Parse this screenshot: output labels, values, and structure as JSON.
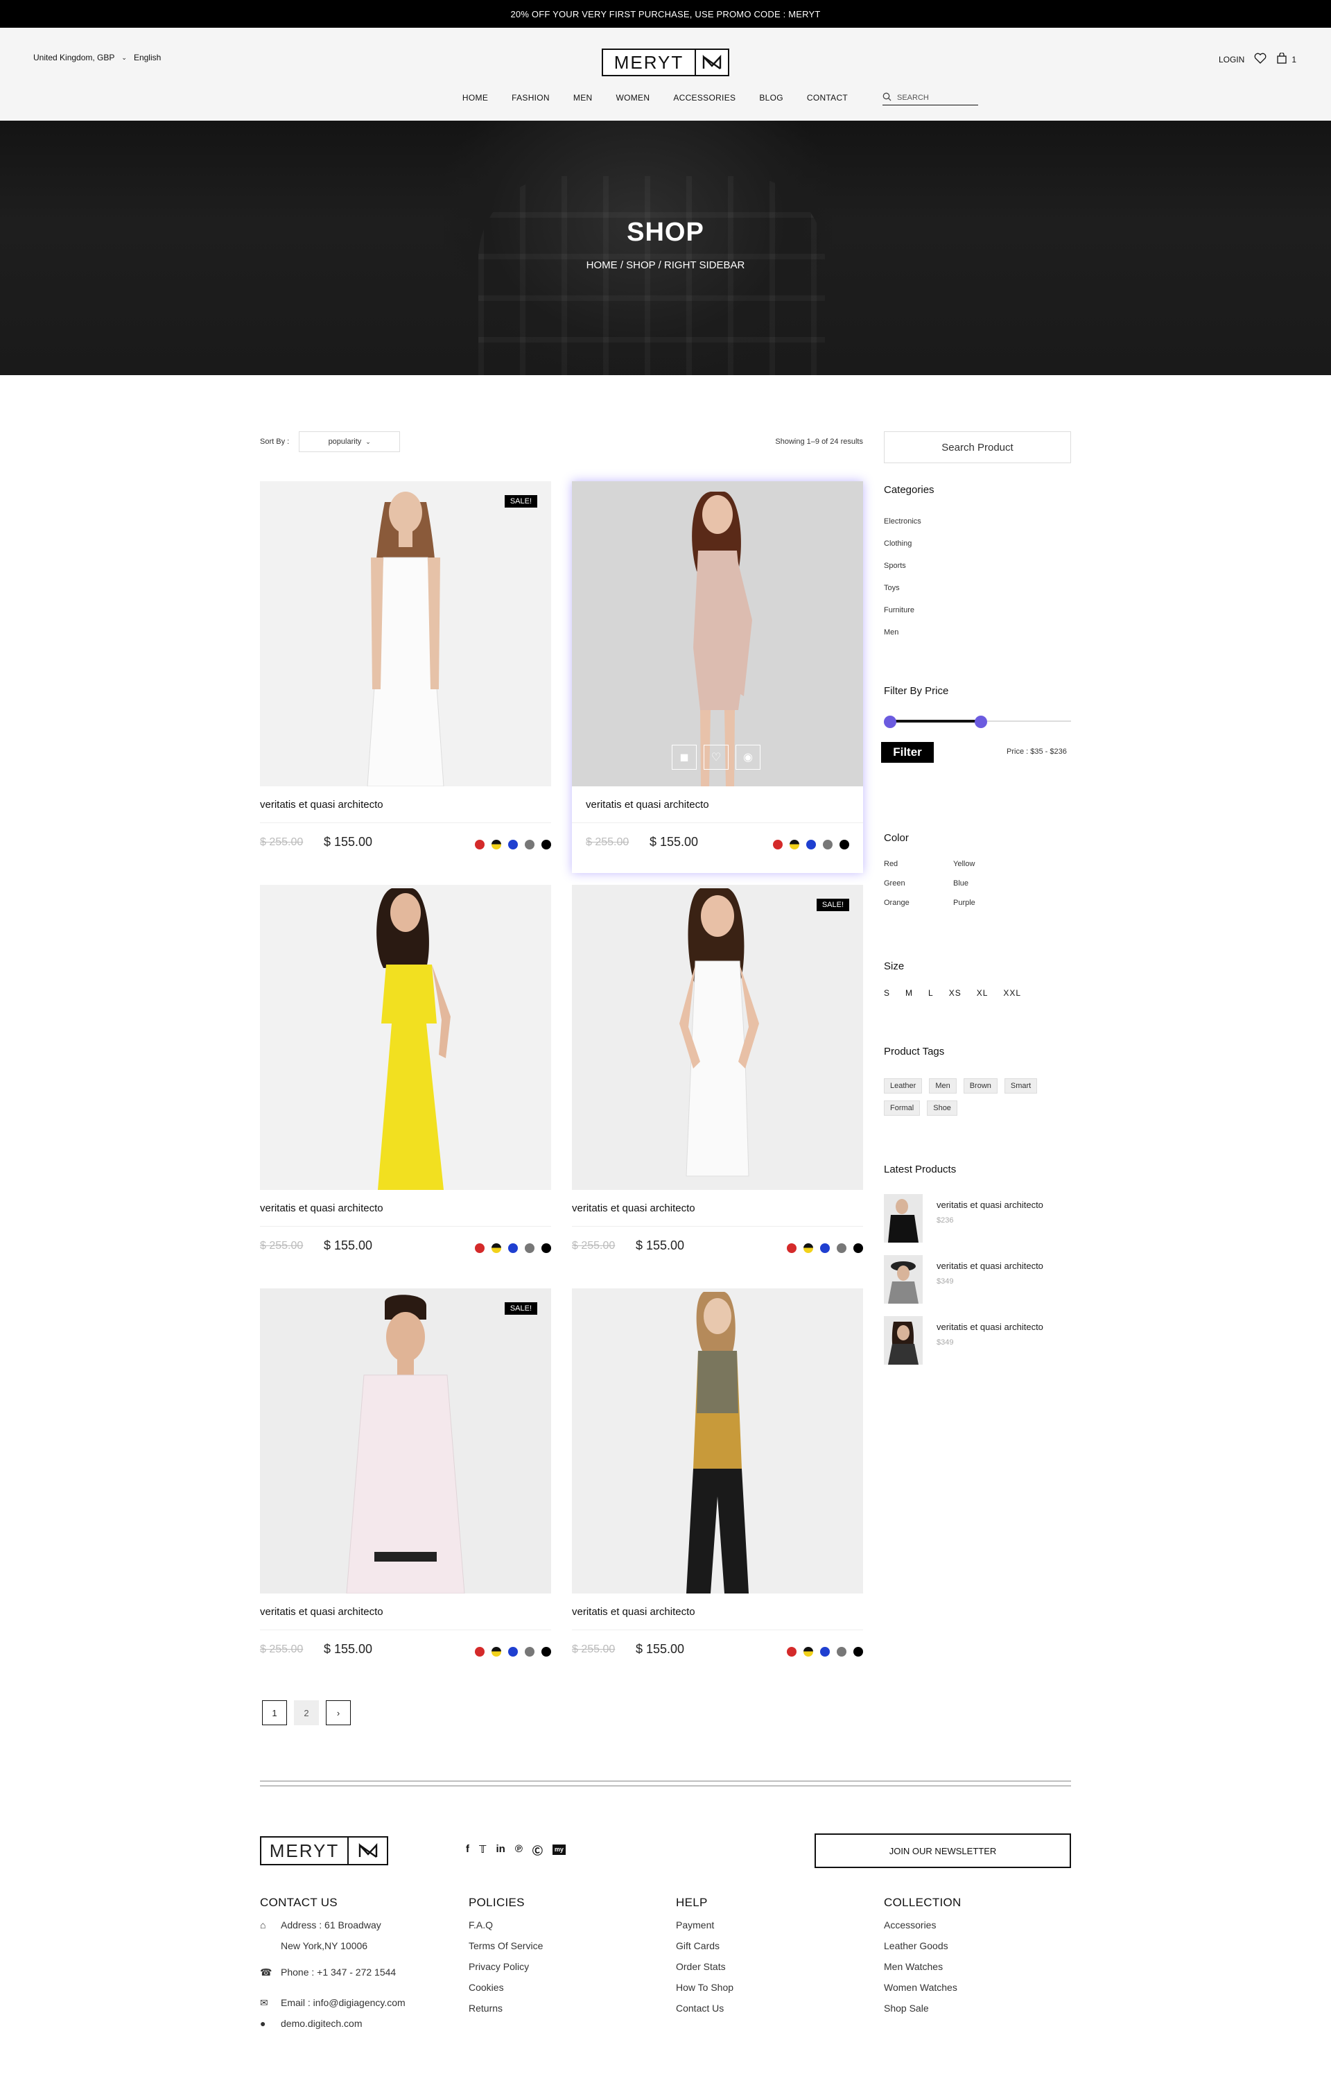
{
  "topbar": {
    "promo": "20% OFF YOUR VERY FIRST PURCHASE, USE PROMO CODE : MERYT"
  },
  "header": {
    "region": "United Kingdom, GBP",
    "language": "English",
    "logo_text": "MERYT",
    "login": "LOGIN",
    "cart_count": "1",
    "nav": [
      "HOME",
      "FASHION",
      "MEN",
      "WOMEN",
      "ACCESSORIES",
      "BLOG",
      "CONTACT"
    ],
    "search_placeholder": "SEARCH"
  },
  "hero": {
    "title": "SHOP",
    "breadcrumb": "HOME / SHOP / RIGHT SIDEBAR"
  },
  "toolbar": {
    "sort_label": "Sort By :",
    "sort_value": "popularity",
    "showing": "Showing 1–9 of 24 results"
  },
  "products": [
    {
      "title": "veritatis et quasi architecto",
      "old_price": "$ 255.00",
      "price": "$ 155.00",
      "sale": "SALE!"
    },
    {
      "title": "veritatis et quasi architecto",
      "old_price": "$ 255.00",
      "price": "$ 155.00",
      "sale": ""
    },
    {
      "title": "veritatis et quasi architecto",
      "old_price": "$ 255.00",
      "price": "$ 155.00",
      "sale": ""
    },
    {
      "title": "veritatis et quasi architecto",
      "old_price": "$ 255.00",
      "price": "$ 155.00",
      "sale": "SALE!"
    },
    {
      "title": "veritatis et quasi architecto",
      "old_price": "$ 255.00",
      "price": "$ 155.00",
      "sale": "SALE!"
    },
    {
      "title": "veritatis et quasi architecto",
      "old_price": "$ 255.00",
      "price": "$ 155.00",
      "sale": ""
    }
  ],
  "swatch_colors": [
    "#d42a2a",
    "#f2d21b",
    "#1f3fd0",
    "#777777",
    "#000000"
  ],
  "pagination": {
    "pages": [
      "1",
      "2"
    ],
    "next": "›"
  },
  "sidebar": {
    "search_label": "Search Product",
    "categories_title": "Categories",
    "categories": [
      "Electronics",
      "Clothing",
      "Sports",
      "Toys",
      "Furniture",
      "Men"
    ],
    "price_title": "Filter By Price",
    "price_range": {
      "min": 0,
      "max": 1,
      "low": 0.0,
      "high": 0.52
    },
    "filter_button": "Filter",
    "price_text": "Price : $35 - $236",
    "color_title": "Color",
    "colors": [
      "Red",
      "Yellow",
      "Green",
      "Blue",
      "Orange",
      "Purple"
    ],
    "size_title": "Size",
    "sizes": [
      "S",
      "M",
      "L",
      "XS",
      "XL",
      "XXL"
    ],
    "tags_title": "Product Tags",
    "tags": [
      "Leather",
      "Men",
      "Brown",
      "Smart",
      "Formal",
      "Shoe"
    ],
    "latest_title": "Latest Products",
    "latest": [
      {
        "title": "veritatis et quasi architecto",
        "price": "$236"
      },
      {
        "title": "veritatis et quasi architecto",
        "price": "$349"
      },
      {
        "title": "veritatis et quasi architecto",
        "price": "$349"
      }
    ]
  },
  "footer": {
    "logo_text": "MERYT",
    "social_icons": [
      "facebook-icon",
      "twitter-icon",
      "linkedin-icon",
      "pinterest-icon",
      "skype-icon",
      "myspace-icon"
    ],
    "newsletter_button": "JOIN OUR NEWSLETTER",
    "contact_title": "CONTACT US",
    "address_1": "Address : 61 Broadway",
    "address_2": "New York,NY 10006",
    "phone": "Phone : +1 347 - 272 1544",
    "email": "Email : info@digiagency.com",
    "website": "demo.digitech.com",
    "policies_title": "POLICIES",
    "policies": [
      "F.A.Q",
      "Terms Of Service",
      "Privacy Policy",
      "Cookies",
      "Returns"
    ],
    "help_title": "HELP",
    "help": [
      "Payment",
      "Gift Cards",
      "Order Stats",
      "How To Shop",
      "Contact Us"
    ],
    "collection_title": "COLLECTION",
    "collection": [
      "Accessories",
      "Leather Goods",
      "Men Watches",
      "Women Watches",
      "Shop Sale"
    ]
  }
}
